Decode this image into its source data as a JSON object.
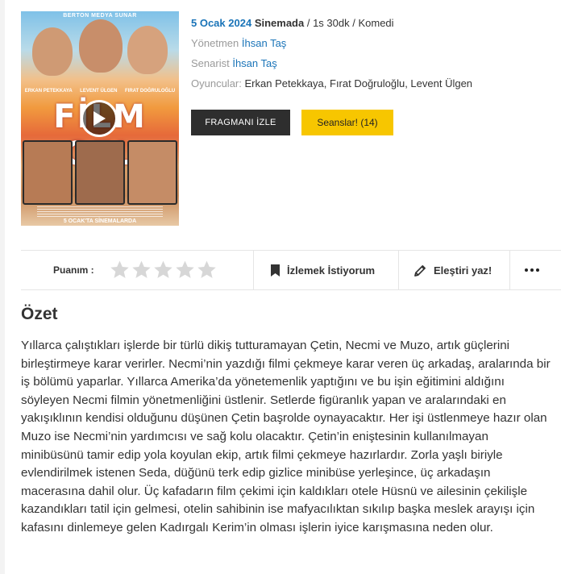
{
  "movie": {
    "release_date": "5 Ocak 2024",
    "status": "Sinemada",
    "separator1": " / ",
    "duration": "1s 30dk",
    "separator2": " / ",
    "genre": "Komedi",
    "director_label": "Yönetmen",
    "director": "İhsan Taş",
    "writer_label": "Senarist",
    "writer": "İhsan Taş",
    "cast_label": "Oyuncular:",
    "cast": "Erkan Petekkaya, Fırat Doğruloğlu, Levent Ülgen"
  },
  "poster": {
    "top_line": "BERTON MEDYA SUNAR",
    "names": [
      "ERKAN PETEKKAYA",
      "LEVENT ÜLGEN",
      "FIRAT DOĞRULOĞLU"
    ],
    "logo": "FİLM GEL",
    "release_line": "5 OCAK'TA SİNEMALARDA"
  },
  "buttons": {
    "trailer": "FRAGMANI İZLE",
    "sessions": "Seanslar! (14)"
  },
  "actions": {
    "rating_label": "Puanım :",
    "stars_count": 5,
    "stars_filled": 0,
    "watchlist": "İzlemek İstiyorum",
    "review": "Eleştiri yaz!"
  },
  "summary": {
    "title": "Özet",
    "text": "Yıllarca çalıştıkları işlerde bir türlü dikiş tutturamayan Çetin, Necmi ve Muzo, artık güçlerini birleştirmeye karar verirler. Necmi’nin yazdığı filmi çekmeye karar veren üç arkadaş, aralarında bir iş bölümü yaparlar. Yıllarca Amerika’da yönetemenlik yaptığını ve bu işin eğitimini aldığını söyleyen Necmi filmin yönetmenliğini üstlenir. Setlerde figüranlık yapan ve aralarındaki en yakışıklının kendisi olduğunu düşünen Çetin başrolde oynayacaktır. Her işi üstlenmeye hazır olan Muzo ise Necmi’nin yardımcısı ve sağ kolu olacaktır. Çetin’in eniştesinin kullanılmayan minibüsünü tamir edip yola koyulan ekip, artık filmi çekmeye hazırlardır. Zorla yaşlı biriyle evlendirilmek istenen Seda, düğünü terk edip gizlice minibüse yerleşince, üç arkadaşın macerasına dahil olur. Üç kafadarın film çekimi için kaldıkları otele Hüsnü ve ailesinin çekilişle kazandıkları tatil için gelmesi, otelin sahibinin ise mafyacılıktan sıkılıp başka meslek arayışı için kafasını dinlemeye gelen Kadırgalı Kerim’in olması işlerin iyice karışmasına neden olur."
  },
  "colors": {
    "accent_blue": "#1a74b8",
    "button_dark": "#2e2e2e",
    "button_yellow": "#f7c600",
    "star_empty": "#d7d7d7"
  }
}
